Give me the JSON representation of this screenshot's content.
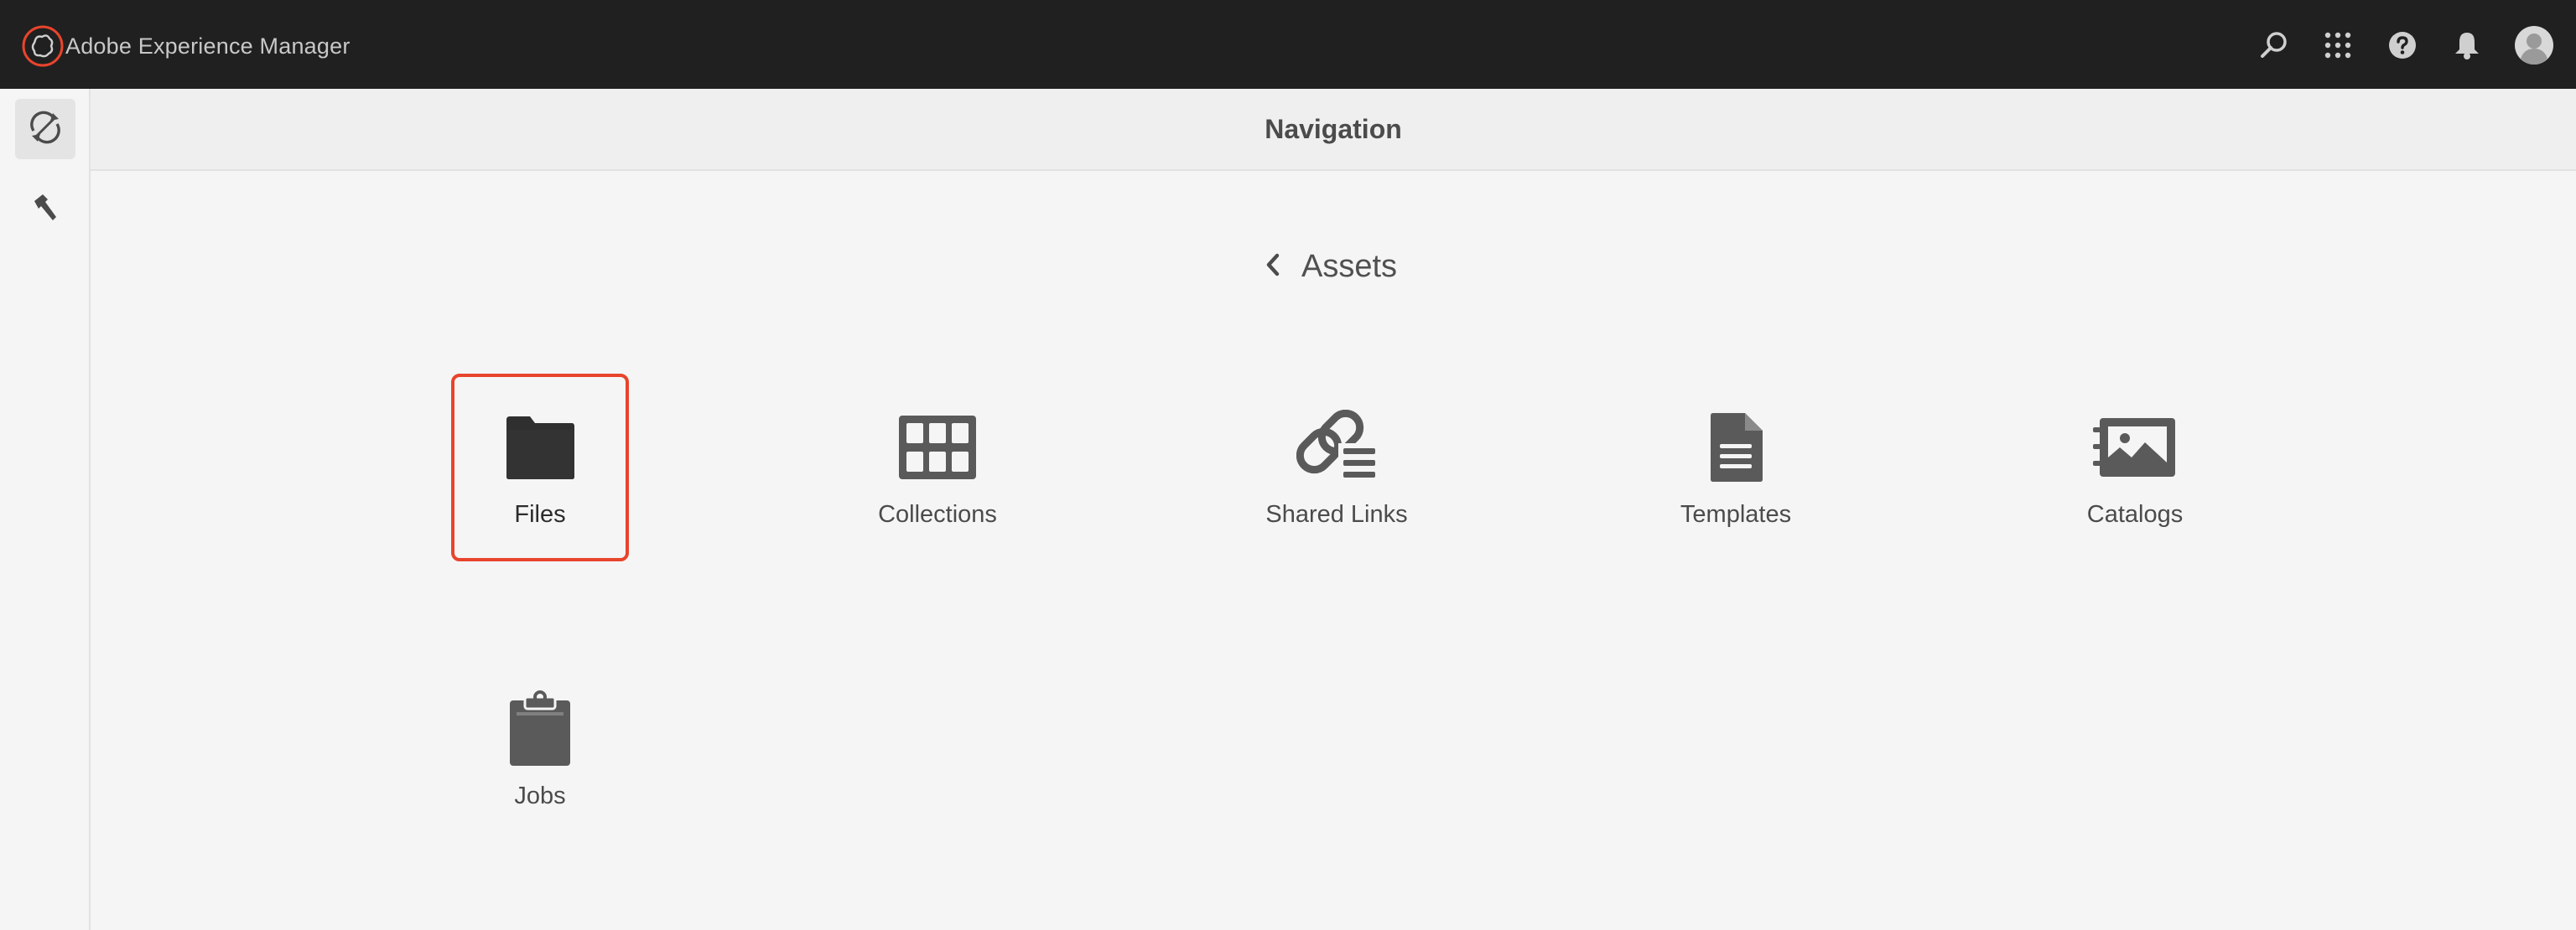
{
  "app": {
    "title": "Adobe Experience Manager",
    "accent": "#e8442c"
  },
  "topbar": {
    "icons": [
      "search-icon",
      "apps-grid-icon",
      "help-icon",
      "bell-icon",
      "avatar"
    ]
  },
  "rail": {
    "items": [
      {
        "name": "navigation-toggle",
        "icon": "navigation-icon",
        "active": true
      },
      {
        "name": "tools",
        "icon": "hammer-icon",
        "active": false
      }
    ]
  },
  "header": {
    "title": "Navigation"
  },
  "breadcrumb": {
    "label": "Assets",
    "icon": "chevron-left-icon"
  },
  "tiles": [
    {
      "label": "Files",
      "icon": "folder-icon",
      "selected": true
    },
    {
      "label": "Collections",
      "icon": "collections-grid-icon",
      "selected": false
    },
    {
      "label": "Shared Links",
      "icon": "shared-links-icon",
      "selected": false
    },
    {
      "label": "Templates",
      "icon": "document-icon",
      "selected": false
    },
    {
      "label": "Catalogs",
      "icon": "catalog-icon",
      "selected": false
    },
    {
      "label": "Jobs",
      "icon": "clipboard-icon",
      "selected": false
    }
  ]
}
